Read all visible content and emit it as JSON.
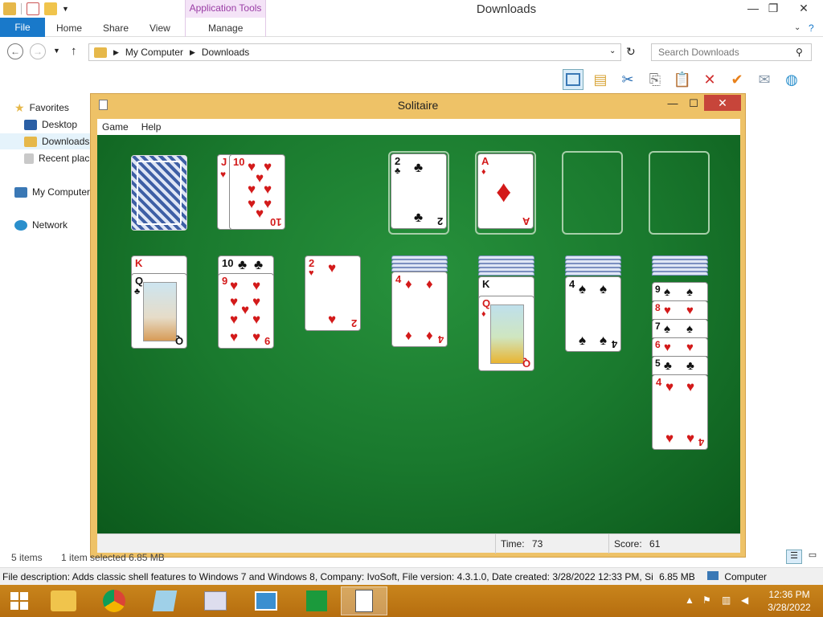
{
  "explorer": {
    "window_title": "Downloads",
    "app_tools": "Application Tools",
    "tabs": {
      "file": "File",
      "home": "Home",
      "share": "Share",
      "view": "View",
      "manage": "Manage"
    },
    "breadcrumb": [
      "My Computer",
      "Downloads"
    ],
    "search_placeholder": "Search Downloads",
    "nav": {
      "favorites": "Favorites",
      "desktop": "Desktop",
      "downloads": "Downloads",
      "recent": "Recent places",
      "computer": "My Computer",
      "network": "Network"
    },
    "items_count": "5 items",
    "selected": "1 item selected  6.85 MB",
    "status_description": "File description: Adds classic shell features to Windows 7 and Windows 8, Company: IvoSoft, File version: 4.3.1.0, Date created: 3/28/2022 12:33 PM, Si",
    "status_size": "6.85 MB",
    "status_location": "Computer"
  },
  "solitaire": {
    "title": "Solitaire",
    "menu": {
      "game": "Game",
      "help": "Help"
    },
    "time_label": "Time:",
    "time_value": "73",
    "score_label": "Score:",
    "score_value": "61"
  },
  "taskbar": {
    "time": "12:36 PM",
    "date": "3/28/2022"
  },
  "colors": {
    "felt": "#1a7a2e",
    "solitaire_frame": "#eec267",
    "file_tab": "#1979ca",
    "taskbar": "#c17a18"
  }
}
